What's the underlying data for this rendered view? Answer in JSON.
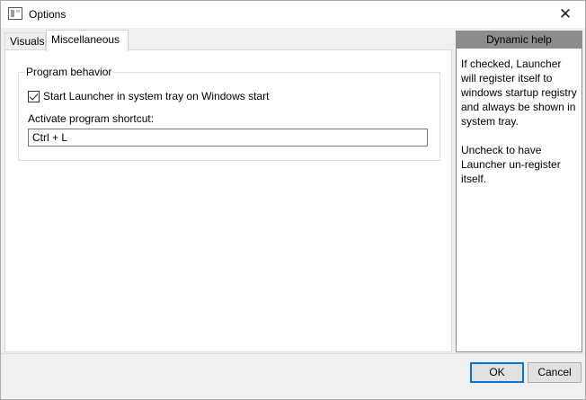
{
  "window": {
    "title": "Options"
  },
  "tabs": [
    {
      "label": "Visuals"
    },
    {
      "label": "Miscellaneous"
    }
  ],
  "program_behavior": {
    "group_label": "Program behavior",
    "start_in_tray_label": "Start Launcher in system tray on Windows start",
    "start_in_tray_checked": true,
    "shortcut_label": "Activate program shortcut:",
    "shortcut_value": "Ctrl + L"
  },
  "dynamic_help": {
    "header": "Dynamic help",
    "paragraph1": "If checked, Launcher will register itself to windows startup registry and always be shown in system tray.",
    "paragraph2": "Uncheck to have Launcher un-register itself."
  },
  "buttons": {
    "ok": "OK",
    "cancel": "Cancel"
  },
  "icons": {
    "app": "window-icon",
    "close": "close-icon"
  }
}
